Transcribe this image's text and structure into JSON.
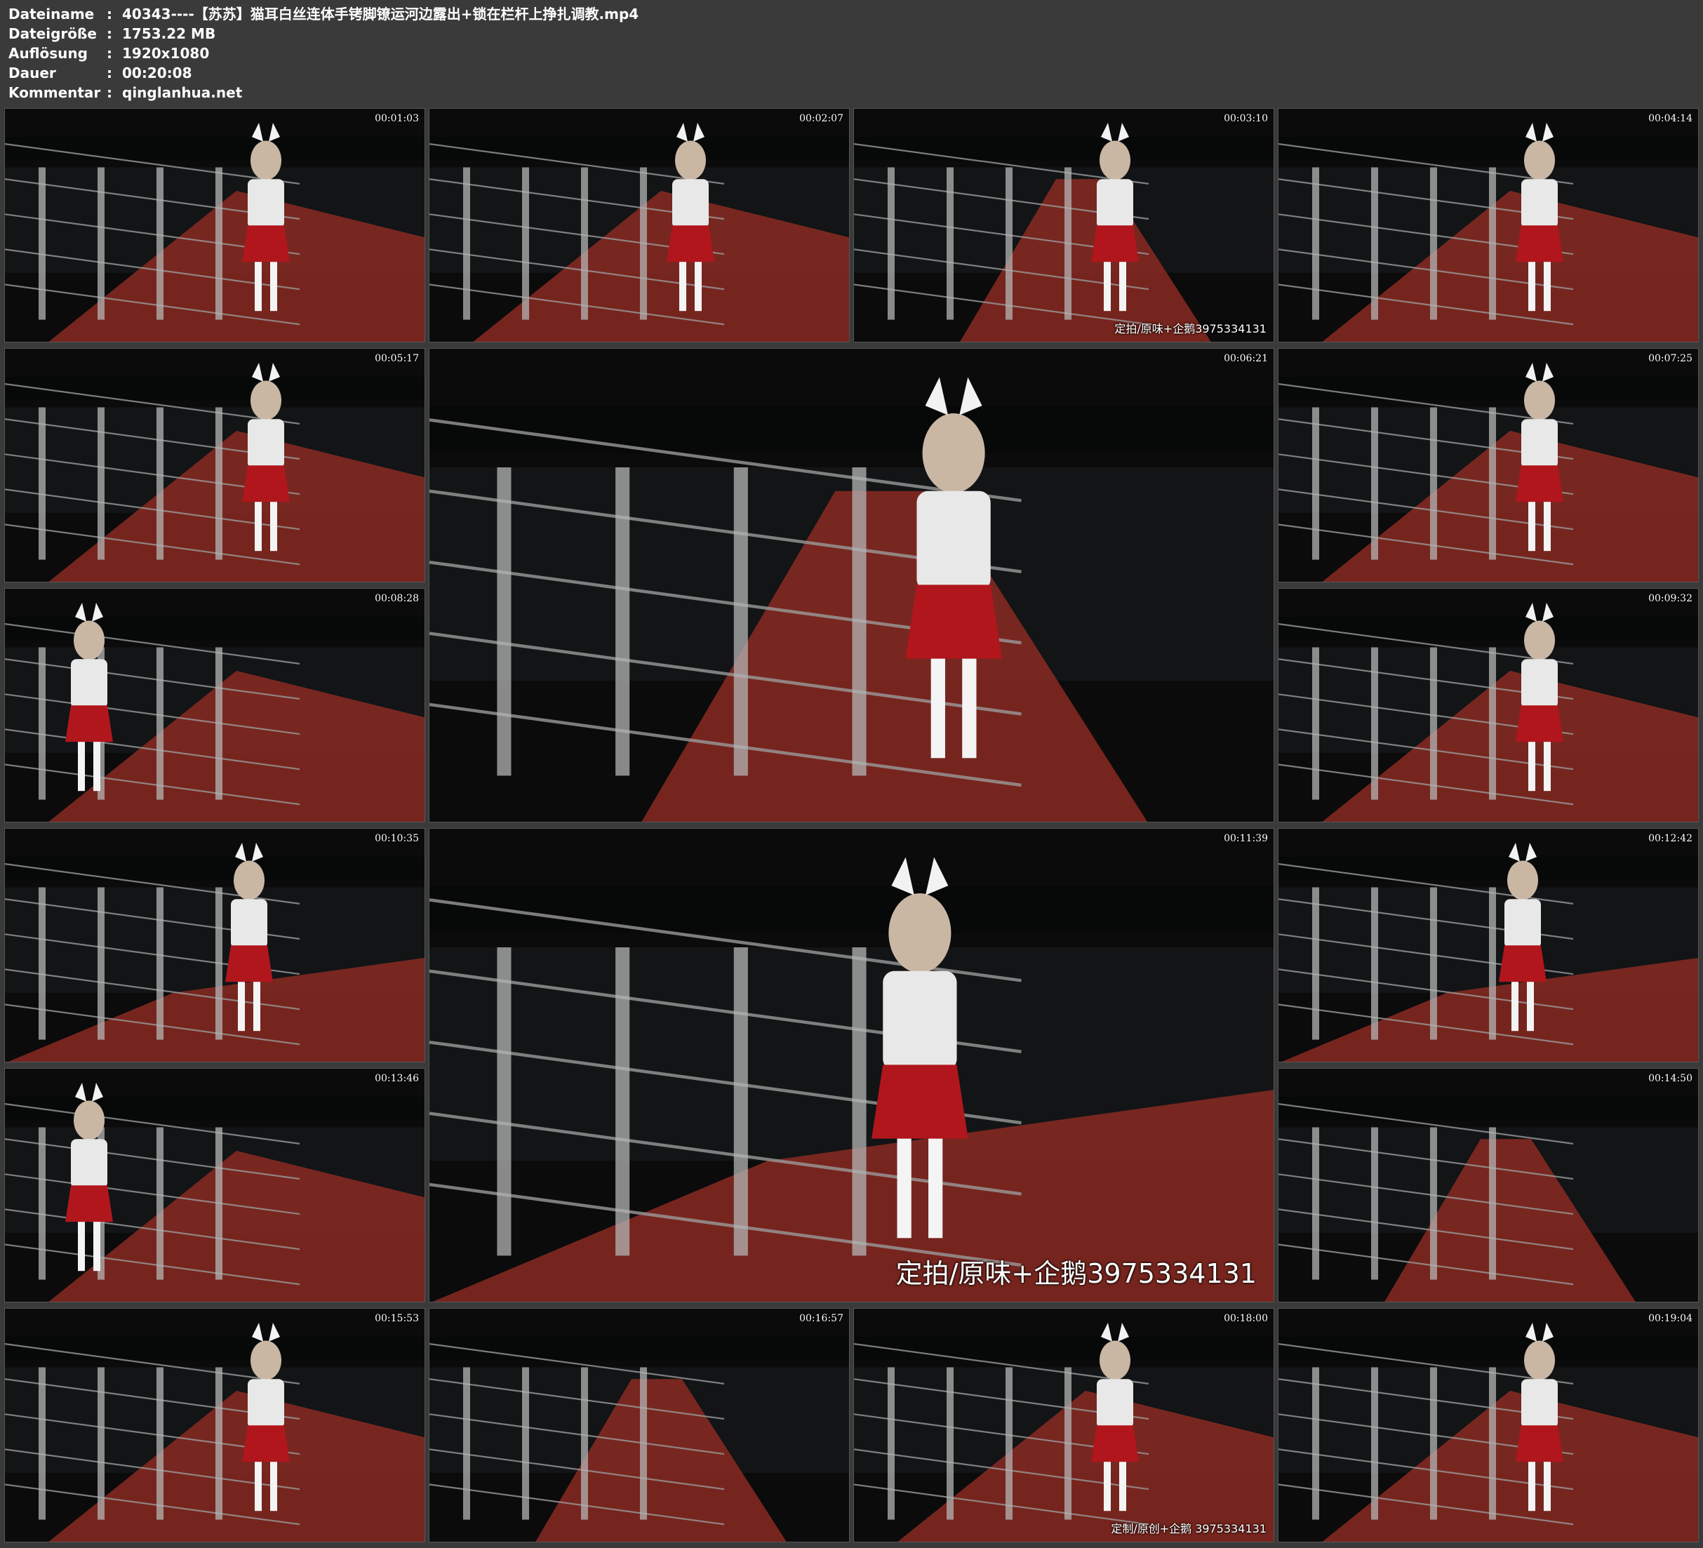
{
  "header": {
    "filename_key": "Dateiname",
    "filename_val": "40343----【苏苏】猫耳白丝连体手铐脚镣运河边露出+锁在栏杆上挣扎调教.mp4",
    "filesize_key": "Dateigröße",
    "filesize_val": "1753.22 MB",
    "resolution_key": "Auflösung",
    "resolution_val": "1920x1080",
    "duration_key": "Dauer",
    "duration_val": "00:20:08",
    "comment_key": "Kommentar",
    "comment_val": "qinglanhua.net",
    "separator": ":"
  },
  "thumbnails": [
    {
      "timestamp": "00:01:03",
      "watermark": ""
    },
    {
      "timestamp": "00:02:07",
      "watermark": ""
    },
    {
      "timestamp": "00:03:10",
      "watermark": "定拍/原味+企鹅3975334131"
    },
    {
      "timestamp": "00:04:14",
      "watermark": ""
    },
    {
      "timestamp": "00:05:17",
      "watermark": ""
    },
    {
      "timestamp": "00:06:21",
      "watermark": ""
    },
    {
      "timestamp": "00:07:25",
      "watermark": ""
    },
    {
      "timestamp": "00:08:28",
      "watermark": ""
    },
    {
      "timestamp": "00:09:32",
      "watermark": ""
    },
    {
      "timestamp": "00:10:35",
      "watermark": ""
    },
    {
      "timestamp": "00:11:39",
      "watermark": "定拍/原味+企鹅3975334131"
    },
    {
      "timestamp": "00:12:42",
      "watermark": ""
    },
    {
      "timestamp": "00:13:46",
      "watermark": ""
    },
    {
      "timestamp": "00:14:50",
      "watermark": ""
    },
    {
      "timestamp": "00:15:53",
      "watermark": ""
    },
    {
      "timestamp": "00:16:57",
      "watermark": ""
    },
    {
      "timestamp": "00:18:00",
      "watermark": "定制/原创+企鹅 3975334131"
    },
    {
      "timestamp": "00:19:04",
      "watermark": ""
    }
  ],
  "colors": {
    "background": "#3a3a3a",
    "header_text": "#ffffff",
    "night_sky": "#0b0b0c",
    "path_red": "#8a2a22",
    "skirt_red": "#b0161c",
    "shirt_white": "#e8e8e8",
    "railing_steel": "#9a9a9a"
  }
}
